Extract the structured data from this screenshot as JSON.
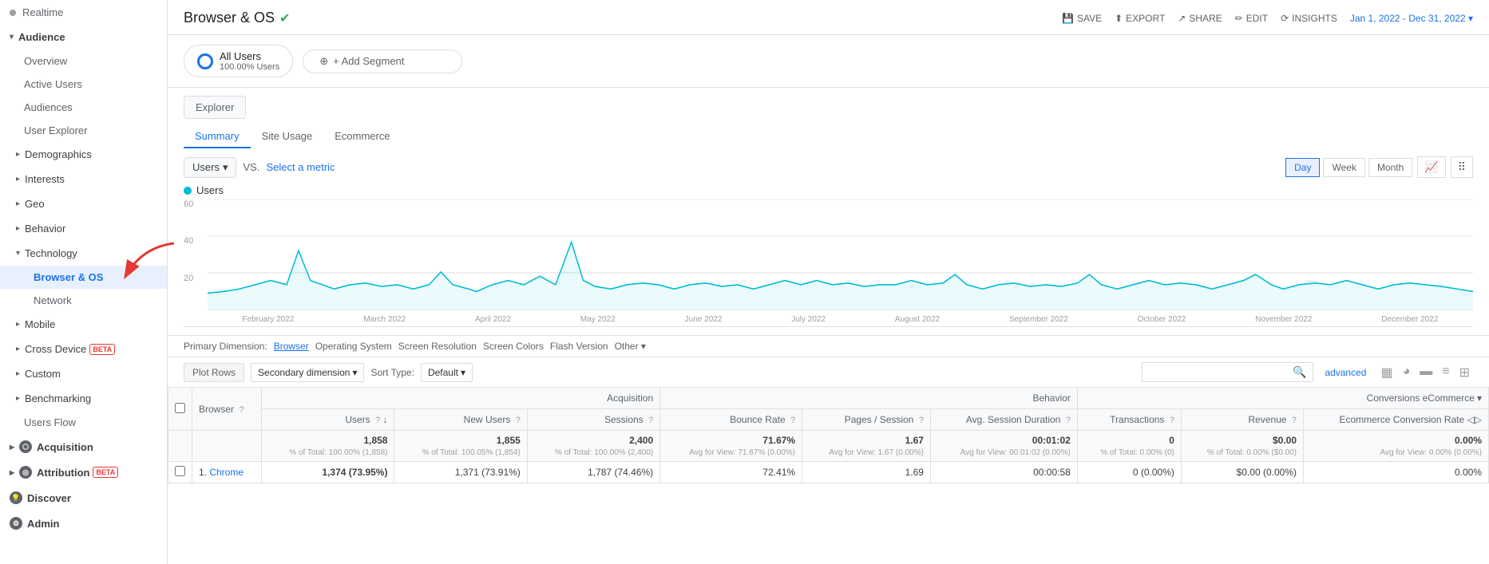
{
  "sidebar": {
    "realtime": "Realtime",
    "audience": "Audience",
    "items": [
      {
        "label": "Overview",
        "type": "item"
      },
      {
        "label": "Active Users",
        "type": "item"
      },
      {
        "label": "Audiences",
        "type": "item"
      },
      {
        "label": "User Explorer",
        "type": "item"
      },
      {
        "label": "Demographics",
        "type": "section"
      },
      {
        "label": "Interests",
        "type": "section"
      },
      {
        "label": "Geo",
        "type": "section"
      },
      {
        "label": "Behavior",
        "type": "section"
      },
      {
        "label": "Technology",
        "type": "section",
        "expanded": true
      },
      {
        "label": "Browser & OS",
        "type": "sub-item",
        "active": true
      },
      {
        "label": "Network",
        "type": "sub-item"
      },
      {
        "label": "Mobile",
        "type": "section"
      },
      {
        "label": "Cross Device",
        "type": "section",
        "badge": "BETA"
      },
      {
        "label": "Custom",
        "type": "section"
      },
      {
        "label": "Benchmarking",
        "type": "section"
      },
      {
        "label": "Users Flow",
        "type": "item"
      }
    ],
    "acquisition": "Acquisition",
    "attribution": "Attribution",
    "attribution_badge": "BETA",
    "discover": "Discover",
    "admin": "Admin"
  },
  "header": {
    "title": "Browser & OS",
    "checkmark": "✓",
    "actions": {
      "save": "SAVE",
      "export": "EXPORT",
      "share": "SHARE",
      "edit": "EDIT",
      "insights": "INSIGHTS"
    },
    "date_range": "Jan 1, 2022 - Dec 31, 2022"
  },
  "segments": {
    "chip1_label": "All Users",
    "chip1_sub": "100.00% Users",
    "add_label": "+ Add Segment"
  },
  "explorer": {
    "tab_label": "Explorer",
    "sub_tabs": [
      "Summary",
      "Site Usage",
      "Ecommerce"
    ]
  },
  "chart": {
    "metric_label": "Users",
    "vs_label": "VS.",
    "select_metric": "Select a metric",
    "time_buttons": [
      "Day",
      "Week",
      "Month"
    ],
    "active_time": "Day",
    "y_labels": [
      "60",
      "40",
      "20"
    ],
    "x_labels": [
      "February 2022",
      "March 2022",
      "April 2022",
      "May 2022",
      "June 2022",
      "July 2022",
      "August 2022",
      "September 2022",
      "October 2022",
      "November 2022",
      "December 2022"
    ],
    "dot_color": "#00bcd4"
  },
  "dimensions": {
    "label": "Primary Dimension:",
    "options": [
      "Browser",
      "Operating System",
      "Screen Resolution",
      "Screen Colors",
      "Flash Version",
      "Other"
    ]
  },
  "table_controls": {
    "plot_rows": "Plot Rows",
    "secondary_dim": "Secondary dimension",
    "sort_type_label": "Sort Type:",
    "sort_type": "Default",
    "search_placeholder": "",
    "advanced": "advanced"
  },
  "table": {
    "group_acquisition": "Acquisition",
    "group_behavior": "Behavior",
    "group_conversions": "Conversions",
    "group_conversions_type": "eCommerce",
    "col_browser": "Browser",
    "col_users": "Users",
    "col_new_users": "New Users",
    "col_sessions": "Sessions",
    "col_bounce_rate": "Bounce Rate",
    "col_pages_session": "Pages / Session",
    "col_avg_session": "Avg. Session Duration",
    "col_transactions": "Transactions",
    "col_revenue": "Revenue",
    "col_ecommerce_rate": "Ecommerce Conversion Rate",
    "totals": {
      "users": "1,858",
      "users_pct": "% of Total: 100.00% (1,858)",
      "new_users": "1,855",
      "new_users_pct": "% of Total: 100.05% (1,854)",
      "sessions": "2,400",
      "sessions_pct": "% of Total: 100.00% (2,400)",
      "bounce_rate": "71.67%",
      "bounce_rate_sub": "Avg for View: 71.67% (0.00%)",
      "pages_session": "1.67",
      "pages_session_sub": "Avg for View: 1.67 (0.00%)",
      "avg_session": "00:01:02",
      "avg_session_sub": "Avg for View: 00:01:02 (0.00%)",
      "transactions": "0",
      "transactions_sub": "% of Total: 0.00% (0)",
      "revenue": "$0.00",
      "revenue_sub": "% of Total: 0.00% ($0.00)",
      "ecommerce_rate": "0.00%",
      "ecommerce_rate_sub": "Avg for View: 0.00% (0.00%)"
    },
    "rows": [
      {
        "num": "1.",
        "browser": "Chrome",
        "users": "1,374 (73.95%)",
        "new_users": "1,371 (73.91%)",
        "sessions": "1,787 (74.46%)",
        "bounce_rate": "72.41%",
        "pages_session": "1.69",
        "avg_session": "00:00:58",
        "transactions": "0 (0.00%)",
        "revenue": "$0.00 (0.00%)",
        "ecommerce_rate": "0.00%"
      }
    ]
  },
  "icons": {
    "save": "💾",
    "export": "⬆",
    "share": "↗",
    "edit": "✏",
    "insights": "⟳",
    "search": "🔍",
    "grid": "▦",
    "pie": "◕",
    "list": "≡",
    "bar": "▬",
    "sparkline": "📈",
    "scatter": "⠿",
    "chevron_down": "▾",
    "chevron_right": "▸",
    "chevron_left": "◂",
    "sort_down": "↓",
    "help": "?"
  }
}
